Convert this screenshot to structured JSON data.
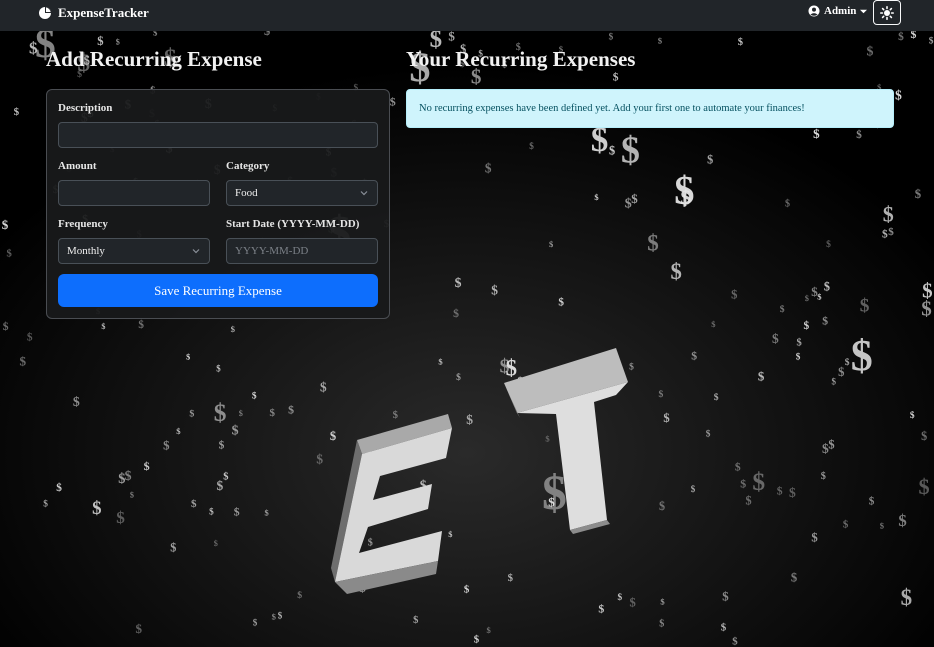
{
  "navbar": {
    "brand": "ExpenseTracker",
    "brand_icon": "pie-chart-icon",
    "user_label": "Admin",
    "user_icon": "user-circle-icon",
    "theme_icon": "sun-icon"
  },
  "form": {
    "title": "Add Recurring Expense",
    "description_label": "Description",
    "description_value": "",
    "amount_label": "Amount",
    "amount_value": "",
    "category_label": "Category",
    "category_value": "Food",
    "frequency_label": "Frequency",
    "frequency_value": "Monthly",
    "start_date_label": "Start Date (YYYY-MM-DD)",
    "start_date_placeholder": "YYYY-MM-DD",
    "save_label": "Save Recurring Expense",
    "save_color": "#0d6efd"
  },
  "list": {
    "title": "Your Recurring Expenses",
    "empty_message": "No recurring expenses have been defined yet. Add your first one to automate your finances!"
  },
  "background": {
    "letters": [
      "E",
      "T"
    ],
    "symbol": "$"
  }
}
